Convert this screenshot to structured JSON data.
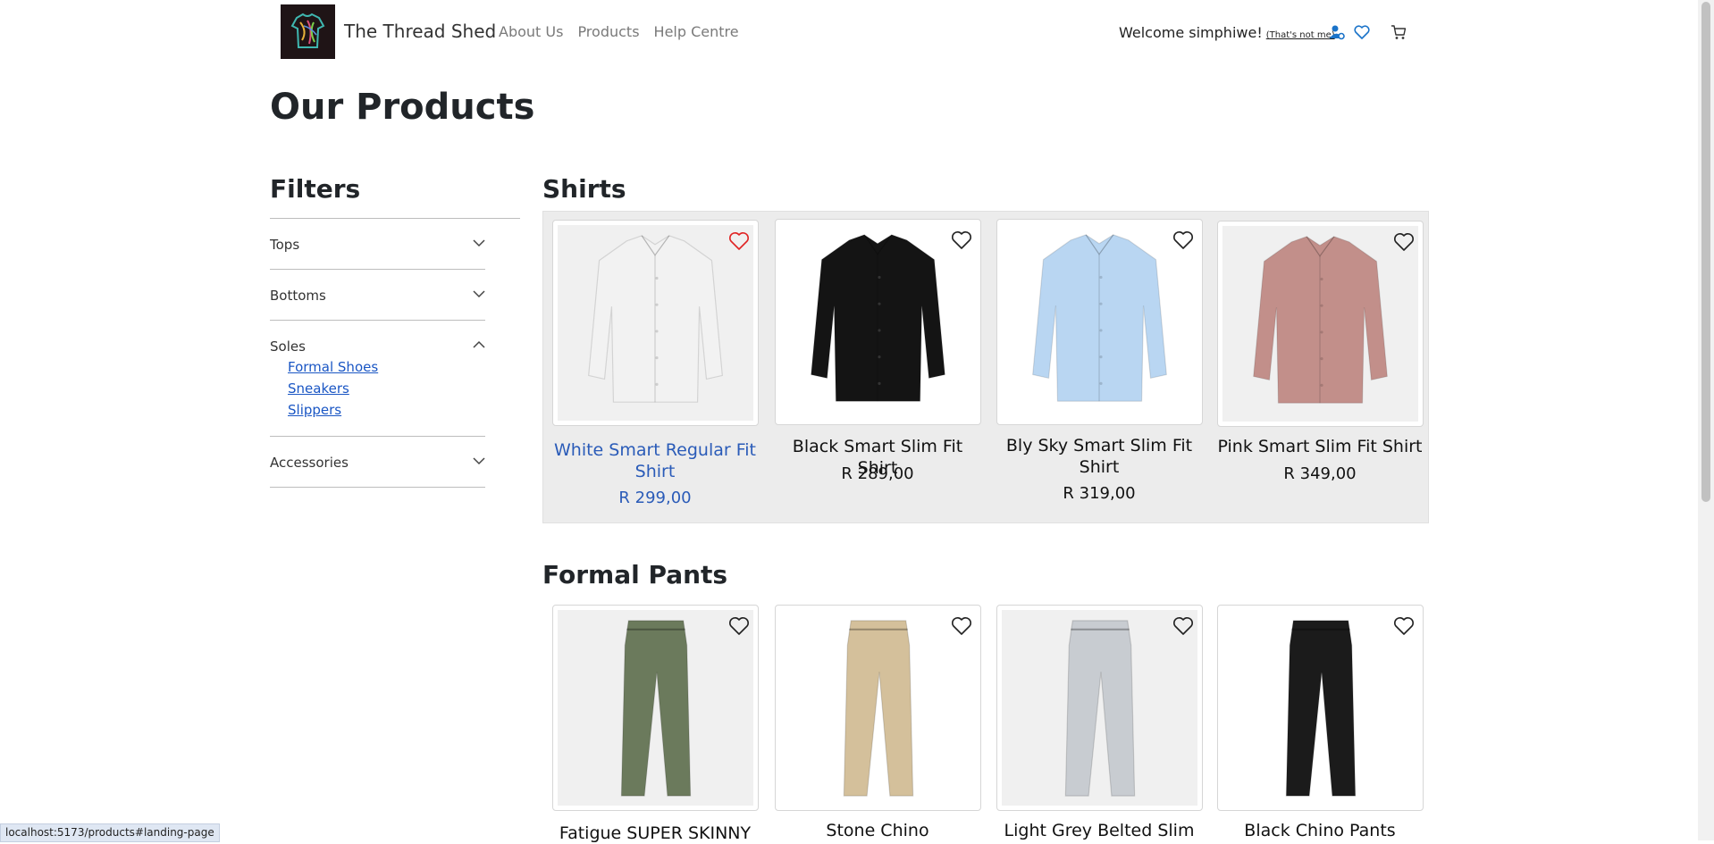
{
  "header": {
    "brand": "The Thread Shed",
    "nav": [
      "About Us",
      "Products",
      "Help Centre"
    ],
    "welcome": "Welcome simphiwe!",
    "not_me": "(That's not me)"
  },
  "page": {
    "title": "Our Products"
  },
  "filters": {
    "title": "Filters",
    "groups": [
      {
        "label": "Tops",
        "expanded": false
      },
      {
        "label": "Bottoms",
        "expanded": false
      },
      {
        "label": "Soles",
        "expanded": true,
        "items": [
          "Formal Shoes",
          "Sneakers",
          "Slippers"
        ]
      },
      {
        "label": "Accessories",
        "expanded": false
      }
    ]
  },
  "sections": [
    {
      "title": "Shirts",
      "products": [
        {
          "name": "White Smart Regular Fit Shirt",
          "price": "R 299,00",
          "favorited": true,
          "color": "#f2f2f2"
        },
        {
          "name": "Black Smart Slim Fit Shirt",
          "price": "R 289,00",
          "favorited": false,
          "color": "#141414"
        },
        {
          "name": "Bly Sky Smart Slim Fit Shirt",
          "price": "R 319,00",
          "favorited": false,
          "color": "#b9d6f2"
        },
        {
          "name": "Pink Smart Slim Fit Shirt",
          "price": "R 349,00",
          "favorited": false,
          "color": "#c28f8a"
        }
      ]
    },
    {
      "title": "Formal Pants",
      "products": [
        {
          "name": "Fatigue SUPER SKINNY",
          "favorited": false,
          "color": "#6b7a5c"
        },
        {
          "name": "Stone Chino",
          "favorited": false,
          "color": "#d4c09b"
        },
        {
          "name": "Light Grey Belted Slim",
          "favorited": false,
          "color": "#c8ccd1"
        },
        {
          "name": "Black Chino Pants",
          "favorited": false,
          "color": "#1b1b1b"
        }
      ]
    }
  ],
  "status_bar": {
    "url": "localhost:5173/products#landing-page"
  },
  "colors": {
    "link": "#1a56c4",
    "favorite": "#e02424",
    "active_product": "#2a5bb8"
  }
}
